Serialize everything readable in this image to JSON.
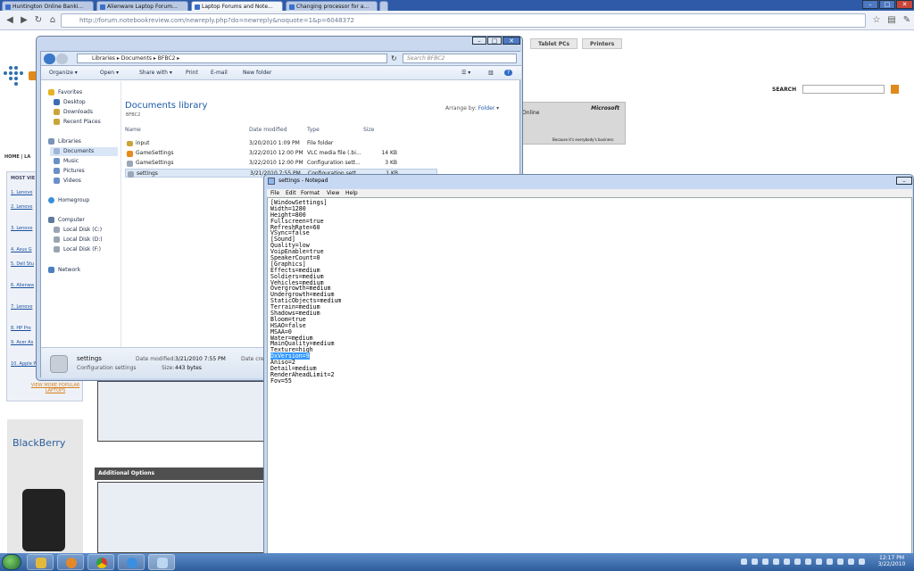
{
  "browser": {
    "tabs": [
      {
        "label": "Huntington Online Banki..."
      },
      {
        "label": "Alienware Laptop Forum..."
      },
      {
        "label": "Laptop Forums and Note..."
      },
      {
        "label": "Changing processor for a..."
      }
    ],
    "url": "http://forum.notebookreview.com/newreply.php?do=newreply&noquote=1&p=6048372"
  },
  "webpage": {
    "nav_tabs": [
      "Tablet PCs",
      "Printers"
    ],
    "search_label": "SEARCH",
    "home_crumb": "HOME",
    "breadcrumb_fragment": "LA",
    "most_viewed_label": "MOST VIE",
    "sidebar_items": [
      "1. Lenovo",
      "2. Lenovo",
      "3. Lenovo",
      "4. Asus G",
      "5. Dell Stu",
      "6. Alienwa",
      "7. Lenovo",
      "8. HP Pro",
      "9. Acer As",
      "10. Apple Pro"
    ],
    "view_more": "VIEW MORE POPULAR LAPTOPS",
    "additional_options": "Additional Options",
    "ms_banner_brand": "Microsoft",
    "ms_banner_tagline": "Because it's everybody's business",
    "ms_banner_left": "Online",
    "blackberry_label": "BlackBerry"
  },
  "explorer": {
    "path": [
      "Libraries",
      "Documents",
      "BFBC2"
    ],
    "search_placeholder": "Search BFBC2",
    "toolbar": {
      "organize": "Organize",
      "open": "Open",
      "share": "Share with",
      "print": "Print",
      "email": "E-mail",
      "new_folder": "New folder"
    },
    "nav": {
      "favorites": "Favorites",
      "desktop": "Desktop",
      "downloads": "Downloads",
      "recent": "Recent Places",
      "libraries": "Libraries",
      "documents": "Documents",
      "music": "Music",
      "pictures": "Pictures",
      "videos": "Videos",
      "homegroup": "Homegroup",
      "computer": "Computer",
      "disk_c": "Local Disk (C:)",
      "disk_d": "Local Disk (D:)",
      "disk_f": "Local Disk (F:)",
      "network": "Network"
    },
    "library_title": "Documents library",
    "library_sub": "BFBC2",
    "arrange_label": "Arrange by:",
    "arrange_value": "Folder",
    "columns": {
      "name": "Name",
      "date": "Date modified",
      "type": "Type",
      "size": "Size"
    },
    "files": [
      {
        "name": "input",
        "date": "3/20/2010 1:09 PM",
        "type": "File folder",
        "size": ""
      },
      {
        "name": "GameSettings",
        "date": "3/22/2010 12:00 PM",
        "type": "VLC media file (.bi...",
        "size": "14 KB"
      },
      {
        "name": "GameSettings",
        "date": "3/22/2010 12:00 PM",
        "type": "Configuration sett...",
        "size": "3 KB"
      },
      {
        "name": "settings",
        "date": "3/21/2010 7:55 PM",
        "type": "Configuration sett...",
        "size": "1 KB"
      }
    ],
    "details": {
      "name": "settings",
      "type": "Configuration settings",
      "modified_label": "Date modified:",
      "modified": "3/21/2010 7:55 PM",
      "created_label": "Date crea",
      "size_label": "Size:",
      "size": "443 bytes"
    }
  },
  "notepad": {
    "title": "settings - Notepad",
    "menu": [
      "File",
      "Edit",
      "Format",
      "View",
      "Help"
    ],
    "lines": [
      "[WindowSettings]",
      "Width=1280",
      "Height=800",
      "Fullscreen=true",
      "RefreshRate=60",
      "VSync=false",
      "[Sound]",
      "Quality=low",
      "VoipEnable=true",
      "SpeakerCount=0",
      "[Graphics]",
      "Effects=medium",
      "Soldiers=medium",
      "Vehicles=medium",
      "Overgrowth=medium",
      "Undergrowth=medium",
      "StaticObjects=medium",
      "Terrain=medium",
      "Shadows=medium",
      "Bloom=true",
      "HSAO=false",
      "MSAA=0",
      "Water=medium",
      "MainQuality=medium",
      "Texture=high",
      "DxVersion=9",
      "Aniso=2",
      "Detail=medium",
      "RenderAheadLimit=2",
      "Fov=55"
    ],
    "selected_line": "DxVersion=9"
  },
  "taskbar": {
    "time": "12:17 PM",
    "date": "3/22/2010"
  }
}
